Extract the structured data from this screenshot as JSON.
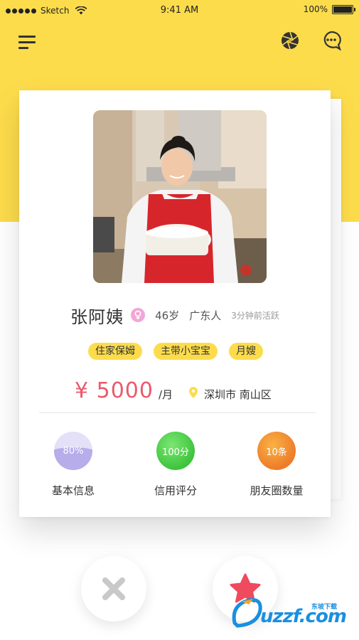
{
  "status_bar": {
    "carrier": "Sketch",
    "time": "9:41 AM",
    "battery": "100%"
  },
  "profile": {
    "name": "张阿姨",
    "age": "46岁",
    "hometown": "广东人",
    "active": "3分钟前活跃",
    "tags": [
      "住家保姆",
      "主带小宝宝",
      "月嫂"
    ],
    "price": "¥ 5000",
    "price_unit": "/月",
    "location": "深圳市 南山区"
  },
  "stats": [
    {
      "value": "80%",
      "label": "基本信息",
      "fill": 0.8
    },
    {
      "value": "100分",
      "label": "信用评分"
    },
    {
      "value": "10条",
      "label": "朋友圈数量"
    }
  ],
  "watermark": {
    "brand": "uzzf.com",
    "sub": "东坡下载"
  },
  "colors": {
    "yellow": "#fddc4c",
    "price": "#ea5a6a",
    "credit": "#3ec43d",
    "moments": "#ee7c2a",
    "info": "#b7adea"
  }
}
